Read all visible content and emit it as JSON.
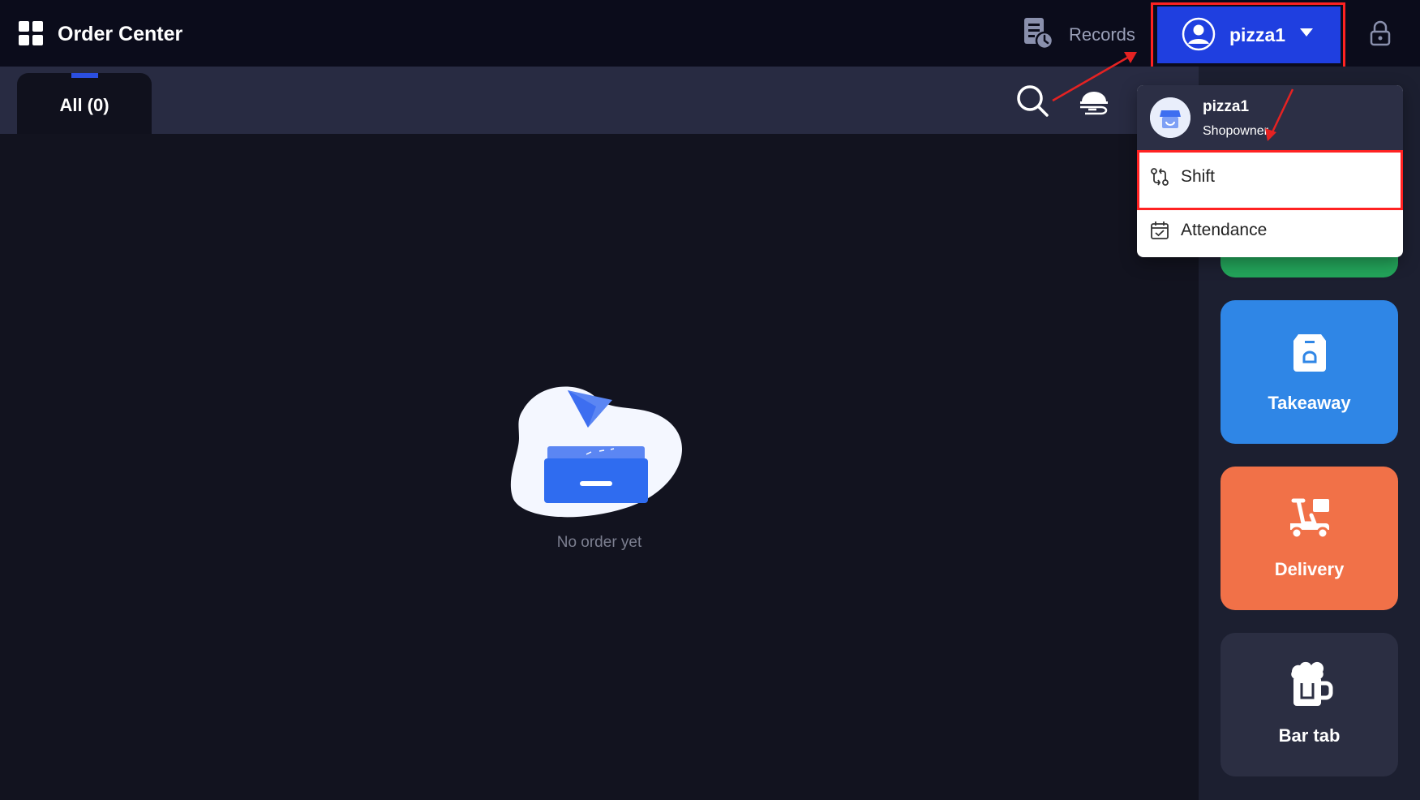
{
  "header": {
    "app_title": "Order Center",
    "app_icon": "grid-menu-icon",
    "records_label": "Records",
    "records_icon": "records-clock-icon",
    "user_name": "pizza1",
    "user_icon": "user-circle-icon",
    "caret_icon": "caret-down-icon",
    "lock_icon": "lock-icon"
  },
  "tabs": [
    {
      "label": "All (0)",
      "active": true
    }
  ],
  "toolbar": {
    "search_icon": "search-icon",
    "delivery_filter_icon": "courier-icon"
  },
  "empty_state": {
    "message": "No order yet",
    "illustration": "empty-inbox-paperplane"
  },
  "dropdown": {
    "user_name": "pizza1",
    "user_role": "Shopowner",
    "items": [
      {
        "label": "Shift",
        "icon": "shift-swap-icon",
        "highlighted": true
      },
      {
        "label": "Attendance",
        "icon": "calendar-check-icon",
        "highlighted": false
      }
    ]
  },
  "order_types": [
    {
      "label": "Takeaway",
      "icon": "takeaway-bag-icon",
      "color": "#2f86e6"
    },
    {
      "label": "Delivery",
      "icon": "scooter-icon",
      "color": "#f17148"
    },
    {
      "label": "Bar tab",
      "icon": "beer-mug-icon",
      "color": "#2b2e42"
    }
  ],
  "colors": {
    "topbar": "#0b0c1b",
    "user_button": "#1f3fe0",
    "highlight": "#ff2222",
    "dine_in_card": "#23a45a"
  }
}
